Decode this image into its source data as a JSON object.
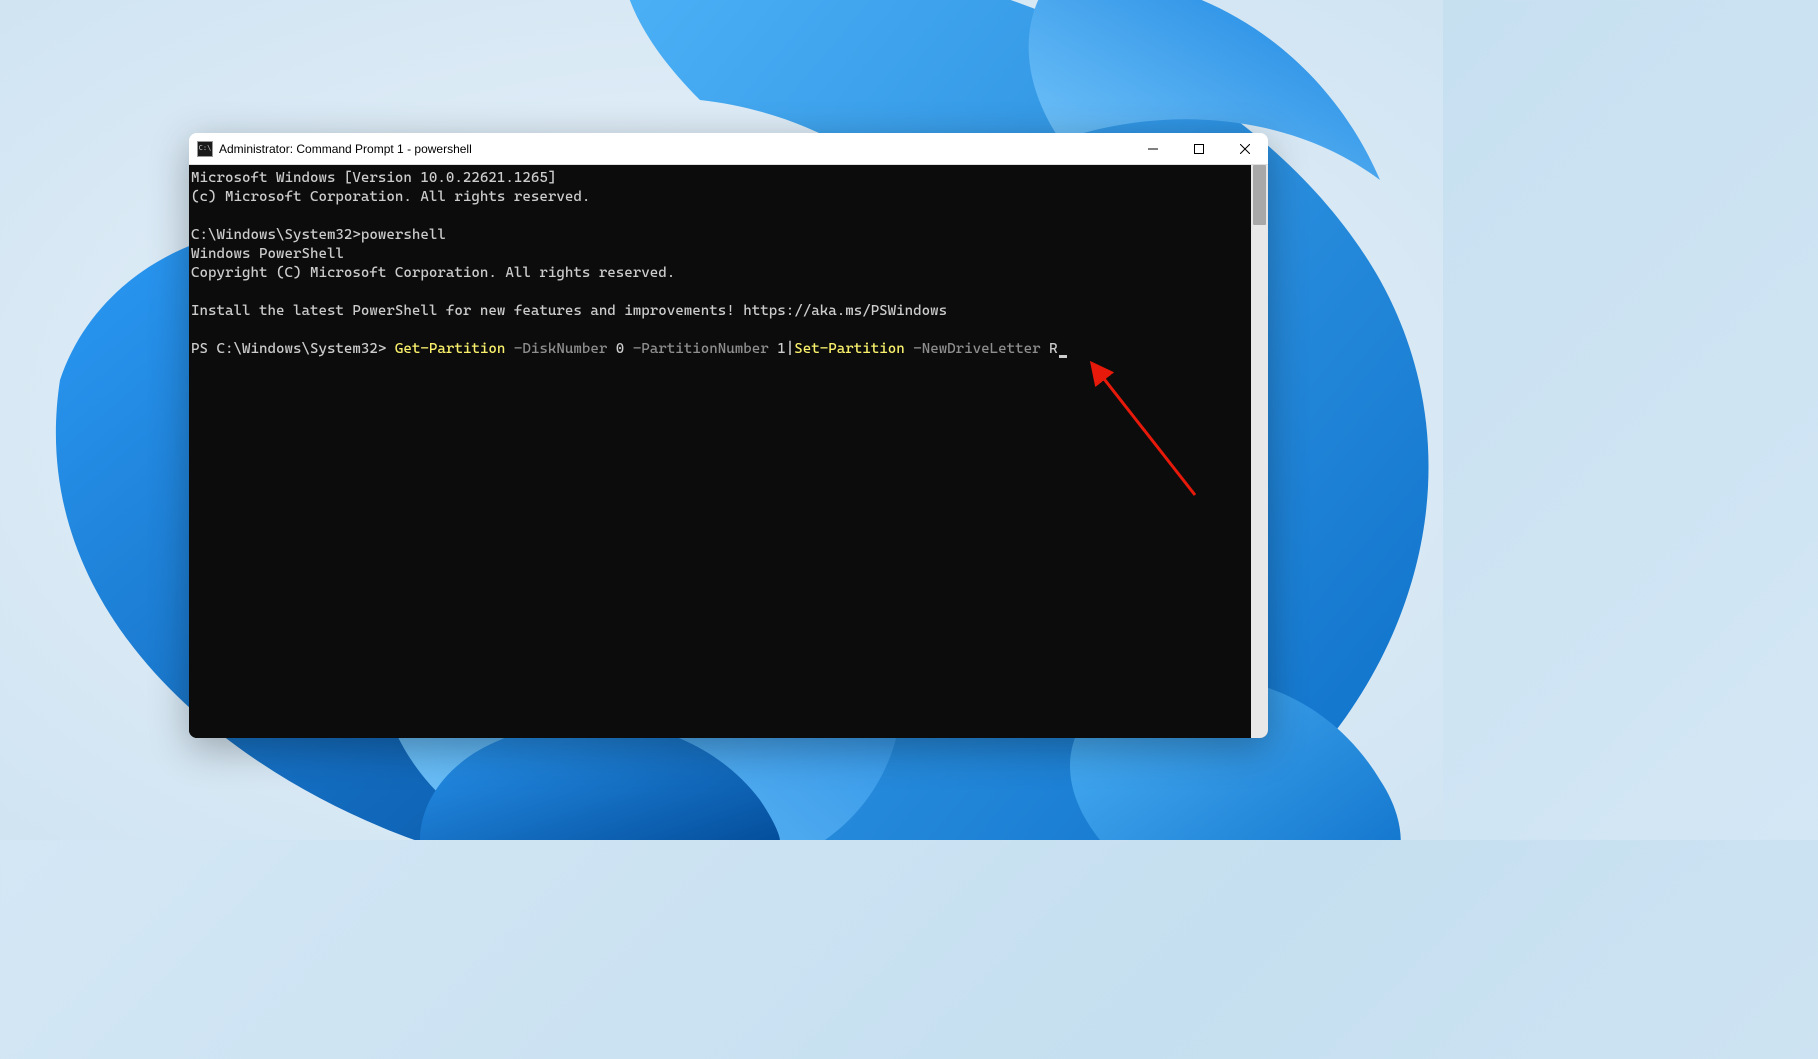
{
  "window": {
    "title": "Administrator: Command Prompt 1 - powershell"
  },
  "terminal": {
    "line1": "Microsoft Windows [Version 10.0.22621.1265]",
    "line2": "(c) Microsoft Corporation. All rights reserved.",
    "line3_prompt": "C:\\Windows\\System32>",
    "line3_cmd": "powershell",
    "line4": "Windows PowerShell",
    "line5": "Copyright (C) Microsoft Corporation. All rights reserved.",
    "line6": "Install the latest PowerShell for new features and improvements! https://aka.ms/PSWindows",
    "ps_prompt": "PS C:\\Windows\\System32> ",
    "cmd1": "Get-Partition",
    "param1": " -DiskNumber",
    "arg1": " 0 ",
    "param2": "-PartitionNumber",
    "arg2": " 1",
    "pipe": "|",
    "cmd2": "Set-Partition",
    "param3": " -NewDriveLetter",
    "arg3": " R"
  }
}
